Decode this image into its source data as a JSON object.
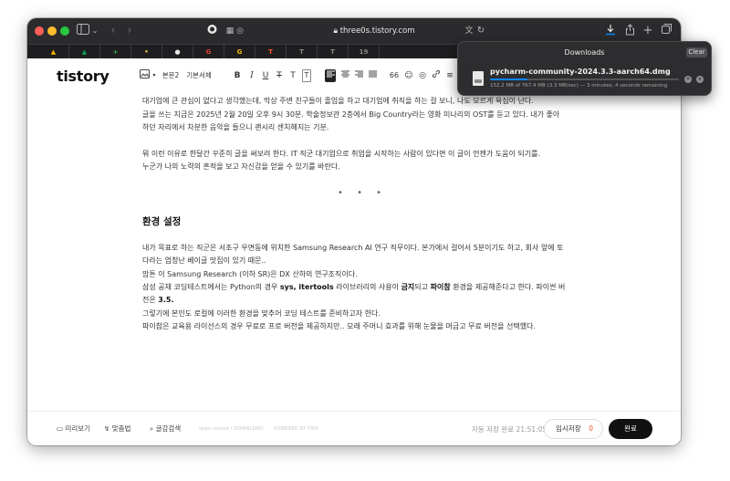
{
  "browser": {
    "url": "three0s.tistory.com",
    "icons": {
      "sidebar": "sidebar-icon",
      "back": "chevron-left-icon",
      "forward": "chevron-right-icon",
      "shield": "shield-icon",
      "tabs_overview": "grid-icon",
      "lock": "lock-icon",
      "translate": "translate-icon",
      "reload": "reload-icon",
      "download": "download-icon",
      "share": "share-icon",
      "new_tab": "plus-icon",
      "show_tabs": "tabs-icon"
    }
  },
  "favorites": [
    {
      "name": "google-drive",
      "glyph": "▲",
      "color": "#f4b400"
    },
    {
      "name": "google-drive-2",
      "glyph": "▲",
      "color": "#0f9d58"
    },
    {
      "name": "sheets",
      "glyph": "+",
      "color": "#34a853"
    },
    {
      "name": "fav-face",
      "glyph": "•",
      "color": "#f7c948"
    },
    {
      "name": "github",
      "glyph": "●",
      "color": "#e6e6e6"
    },
    {
      "name": "google-1",
      "glyph": "G",
      "color": "#ea4335"
    },
    {
      "name": "google-2",
      "glyph": "G",
      "color": "#fbbc05"
    },
    {
      "name": "tistory-1",
      "glyph": "T",
      "color": "#ff5722"
    },
    {
      "name": "tistory-2",
      "glyph": "T",
      "color": "#888888"
    },
    {
      "name": "tistory-3",
      "glyph": "T",
      "color": "#888888"
    },
    {
      "name": "fav-19",
      "glyph": "19",
      "color": "#888888"
    }
  ],
  "editor": {
    "logo": "tistory",
    "toolbar": {
      "image": "image-icon",
      "heading": "본문2",
      "font": "기본서체",
      "bold": "B",
      "italic": "I",
      "underline": "U",
      "strike": "T",
      "text_color": "T",
      "bg_color": "T",
      "align_left": "align-left-icon",
      "align_center": "align-center-icon",
      "align_right": "align-right-icon",
      "align_justify": "align-justify-icon",
      "quote": "66",
      "emoji": "☺",
      "map": "◎",
      "link": "link-icon",
      "more": "≡"
    },
    "paragraphs": {
      "p1": "대기업에 큰 관심이 없다고 생각했는데, 막상 주변 친구들이 졸업을 하고 대기업에 취직을 하는 걸 보니, 나도 모르게 욕심이 난다.",
      "p2": "글을 쓰는 지금은 2025년 2월 20일 오후 9시 30분. 학술정보관 2층에서 Big Country라는 영화 미나리의 OST를 듣고 있다. 내가 좋아",
      "p3": "하던 자리에서 차분한 음악을 들으니 괜시리 센치해지는 기분.",
      "p4": "뭐 이런 이유로 한달간 꾸준히 글을 써보려 한다. IT 직군 대기업으로 취업을 시작하는 사람이 있다면 이 글이 언젠가 도움이 되기를.",
      "p5": "누군가 나의 노력의 흔적을 보고 자신감을 얻을 수 있기를 바란다.",
      "divider": "• • •",
      "h2": "환경 설정",
      "p6": "내가 목표로 하는 직군은 서초구 우면동에 위치한 Samsung Research AI 연구 직무이다. 본가에서 걸어서 5분이기도 하고, 회사 앞에 토",
      "p7": "다라는 엄청난 베이글 맛집이 있기 때문..",
      "p8": "맘튼 이 Samsung Research (이하 SR)은 DX 산하의 연구조직이다.",
      "p9_a": "삼성 공채 코딩테스트에서는 Python의 경우 ",
      "p9_b": "sys, itertools",
      "p9_c": " 라이브러리의 사용이 ",
      "p9_d": "금지",
      "p9_e": "되고 ",
      "p9_f": "파이참",
      "p9_g": " 환경을 제공해준다고 한다. 파이썬 버",
      "p10_a": "전은 ",
      "p10_b": "3.5.",
      "p11": "그렇기에 본인도 로컬에 이러한 환경을 맞추어 코딩 테스트를 준비하고자 한다.",
      "p12": "파이참은 교육용 라이선스의 경우 무료로 프로 버전을 제공하지만.. 모래 주머니 효과를 위해 눈물을 머금고 무료 버전을 선택했다."
    },
    "footer": {
      "preview": "미리보기",
      "spellcheck": "맞춤법",
      "search": "글감검색",
      "open_source": "open source / DOWNLOAD",
      "powered": "POWERED BY TINY",
      "autosave": "자동 저장 완료 21:51:05",
      "temp_save": "임시저장",
      "temp_count": "0",
      "done": "완료"
    }
  },
  "downloads": {
    "title": "Downloads",
    "clear": "Clear",
    "file_name": "pycharm-community-2024.3.3-aarch64.dmg",
    "status": "152.2 MB of 767.4 MB (3.3 MB/sec) — 3 minutes, 4 seconds remaining",
    "progress_fraction": 0.198
  }
}
